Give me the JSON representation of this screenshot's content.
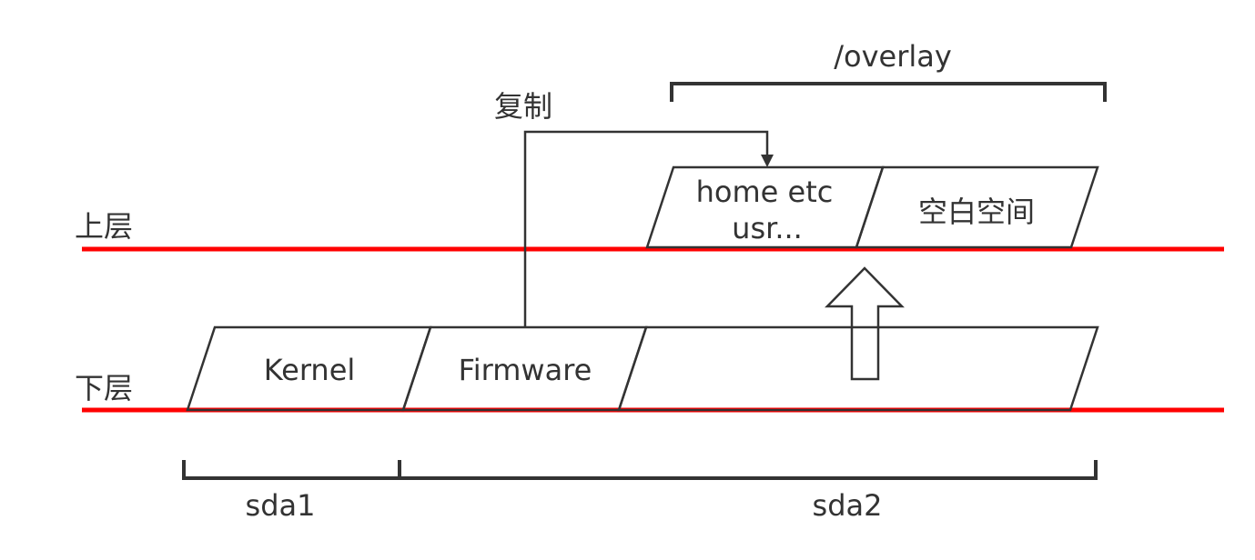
{
  "layers": {
    "upper_label": "上层",
    "lower_label": "下层"
  },
  "segments": {
    "kernel": "Kernel",
    "firmware": "Firmware",
    "upper_data_line1": "home etc",
    "upper_data_line2": "usr...",
    "blank_space": "空白空间"
  },
  "annotations": {
    "copy": "复制",
    "overlay": "/overlay"
  },
  "partitions": {
    "sda1": "sda1",
    "sda2": "sda2"
  },
  "colors": {
    "layer_line": "#ff0000",
    "stroke": "#333333",
    "text": "#333333"
  }
}
